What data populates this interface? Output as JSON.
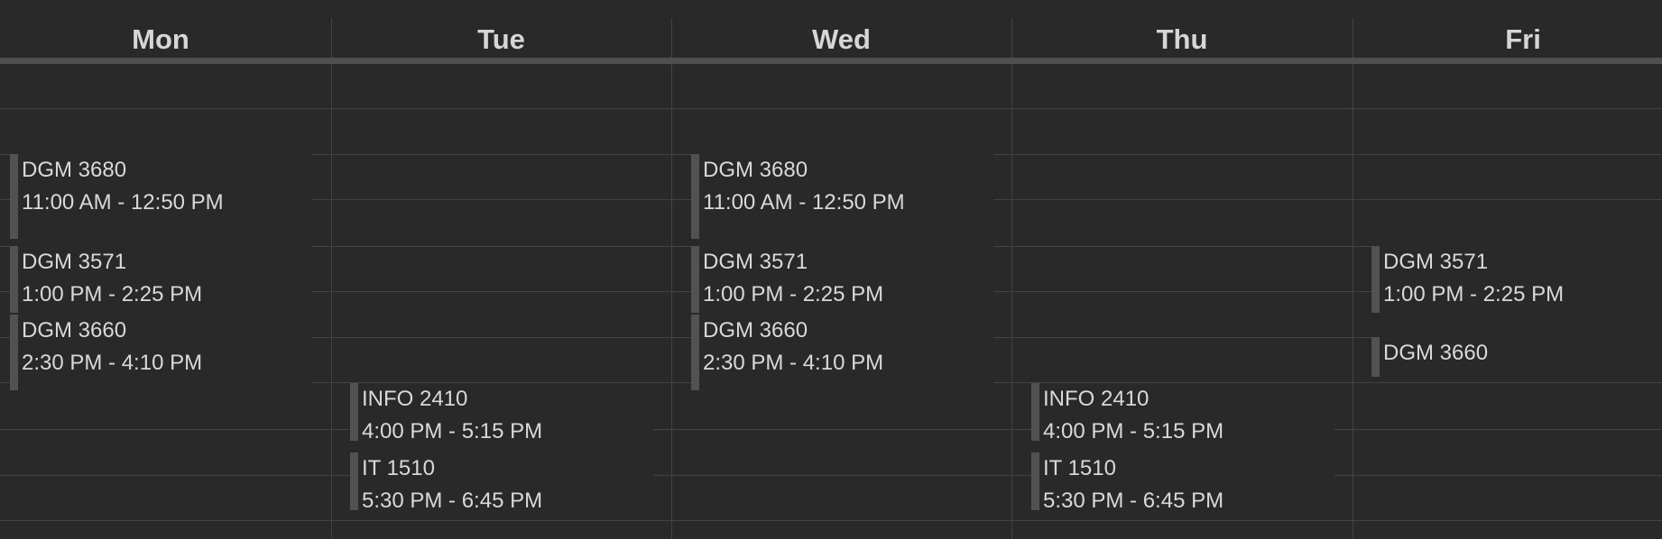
{
  "days": [
    "Mon",
    "Tue",
    "Wed",
    "Thu",
    "Fri"
  ],
  "events": [
    {
      "day": 0,
      "title": "DGM 3680",
      "time": "11:00 AM - 12:50 PM"
    },
    {
      "day": 0,
      "title": "DGM 3571",
      "time": "1:00 PM - 2:25 PM"
    },
    {
      "day": 0,
      "title": "DGM 3660",
      "time": "2:30 PM - 4:10 PM"
    },
    {
      "day": 1,
      "title": "INFO 2410",
      "time": "4:00 PM - 5:15 PM"
    },
    {
      "day": 1,
      "title": "IT 1510",
      "time": "5:30 PM - 6:45 PM"
    },
    {
      "day": 2,
      "title": "DGM 3680",
      "time": "11:00 AM - 12:50 PM"
    },
    {
      "day": 2,
      "title": "DGM 3571",
      "time": "1:00 PM - 2:25 PM"
    },
    {
      "day": 2,
      "title": "DGM 3660",
      "time": "2:30 PM - 4:10 PM"
    },
    {
      "day": 3,
      "title": "INFO 2410",
      "time": "4:00 PM - 5:15 PM"
    },
    {
      "day": 3,
      "title": "IT 1510",
      "time": "5:30 PM - 6:45 PM"
    },
    {
      "day": 4,
      "title": "DGM 3571",
      "time": "1:00 PM - 2:25 PM"
    },
    {
      "day": 4,
      "title": "DGM 3660",
      "time": ""
    }
  ]
}
